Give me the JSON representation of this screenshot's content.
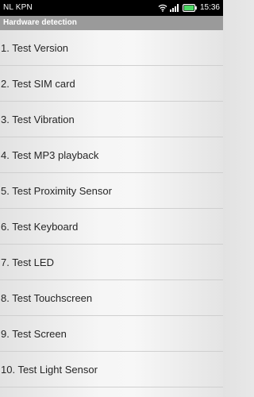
{
  "status_bar": {
    "carrier": "NL KPN",
    "time": "15:36",
    "icons": [
      "wifi-icon",
      "signal-icon",
      "battery-icon"
    ],
    "battery_color": "#4cd964"
  },
  "title_bar": {
    "title": "Hardware detection"
  },
  "tests": [
    {
      "label": "1. Test Version"
    },
    {
      "label": "2. Test SIM card"
    },
    {
      "label": "3. Test Vibration"
    },
    {
      "label": "4. Test MP3 playback"
    },
    {
      "label": "5. Test Proximity Sensor"
    },
    {
      "label": "6. Test Keyboard"
    },
    {
      "label": "7. Test LED"
    },
    {
      "label": "8. Test Touchscreen"
    },
    {
      "label": "9. Test Screen"
    },
    {
      "label": "10. Test Light Sensor"
    }
  ]
}
